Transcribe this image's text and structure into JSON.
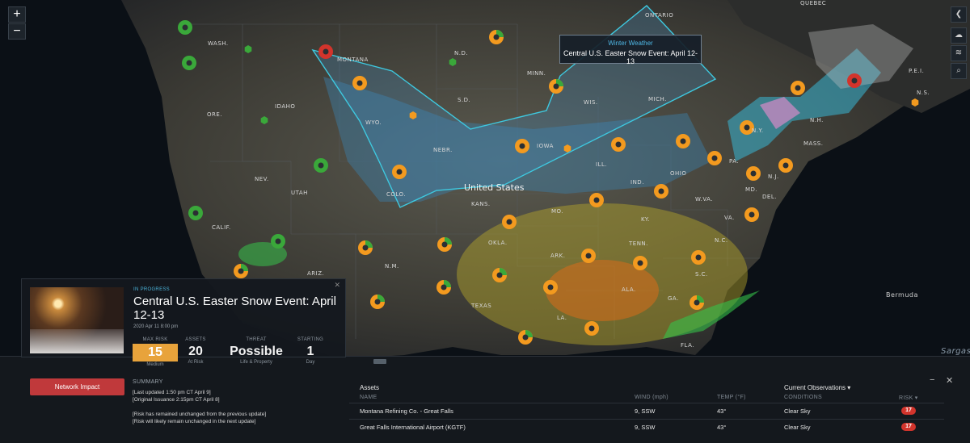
{
  "map": {
    "country_label": "United States",
    "ocean_label": "Bermuda",
    "sargasso_label": "Sargas",
    "region_labels": [
      "ONTARIO",
      "QUEBEC",
      "WASH.",
      "MONTANA",
      "N.D.",
      "MINN.",
      "IDAHO",
      "ORE.",
      "WYO.",
      "S.D.",
      "WIS.",
      "MICH.",
      "NEBR.",
      "IOWA",
      "NEV.",
      "UTAH",
      "COLO.",
      "KANS.",
      "MO.",
      "ILL.",
      "IND.",
      "OHIO",
      "PA.",
      "N.Y.",
      "MASS.",
      "N.H.",
      "CALIF.",
      "OKLA.",
      "ARK.",
      "KY.",
      "TENN.",
      "W.VA.",
      "VA.",
      "N.C.",
      "S.C.",
      "GA.",
      "ALA.",
      "TEXAS",
      "LA.",
      "FLA.",
      "N.M.",
      "ARIZ.",
      "MD.",
      "DEL.",
      "N.J.",
      "P.E.I.",
      "N.S."
    ],
    "zoom_in": "+",
    "zoom_out": "−"
  },
  "tooltip": {
    "category": "Winter Weather",
    "event": "Central U.S. Easter Snow Event: April 12-13"
  },
  "event": {
    "status": "IN PROGRESS",
    "title": "Central U.S. Easter Snow Event: April 12-13",
    "issued": "2020 Apr 11 8:00 pm",
    "close": "✕",
    "metrics": {
      "max_risk_label": "MAX RISK",
      "max_risk_value": "15",
      "max_risk_sub": "Medium",
      "assets_label": "ASSETS",
      "assets_value": "20",
      "assets_sub": "At Risk",
      "threat_label": "THREAT",
      "threat_value": "Possible",
      "threat_sub": "Life & Property",
      "starting_label": "STARTING",
      "starting_value": "1",
      "starting_sub": "Day"
    },
    "risk_color": "#e8a33b"
  },
  "bottom": {
    "network_button": "Network Impact",
    "summary_label": "SUMMARY",
    "summary_lines": [
      "[Last updated 1:50 pm CT April 9]",
      "[Original Issuance 2:15pm CT April 8]",
      "",
      "[Risk has remained unchanged from the previous update]",
      "[Risk will likely remain unchanged in the next update]"
    ],
    "assets_title": "Assets",
    "observations_title": "Current Observations ▾",
    "columns": {
      "name": "NAME",
      "wind": "WIND (mph)",
      "temp": "TEMP (°F)",
      "conditions": "CONDITIONS",
      "risk": "RISK ▾"
    },
    "rows": [
      {
        "name": "Montana Refining Co. - Great Falls",
        "wind": "9, SSW",
        "temp": "43°",
        "conditions": "Clear Sky",
        "risk": "17"
      },
      {
        "name": "Great Falls International Airport (KGTF)",
        "wind": "9, SSW",
        "temp": "43°",
        "conditions": "Clear Sky",
        "risk": "17"
      }
    ],
    "minimize": "−",
    "close": "✕"
  },
  "colors": {
    "accent_blue": "#4bb3d9",
    "risk_red": "#d2342c",
    "button_red": "#c0393b",
    "marker_orange": "#f39a1f",
    "marker_green": "#3aa83a"
  }
}
